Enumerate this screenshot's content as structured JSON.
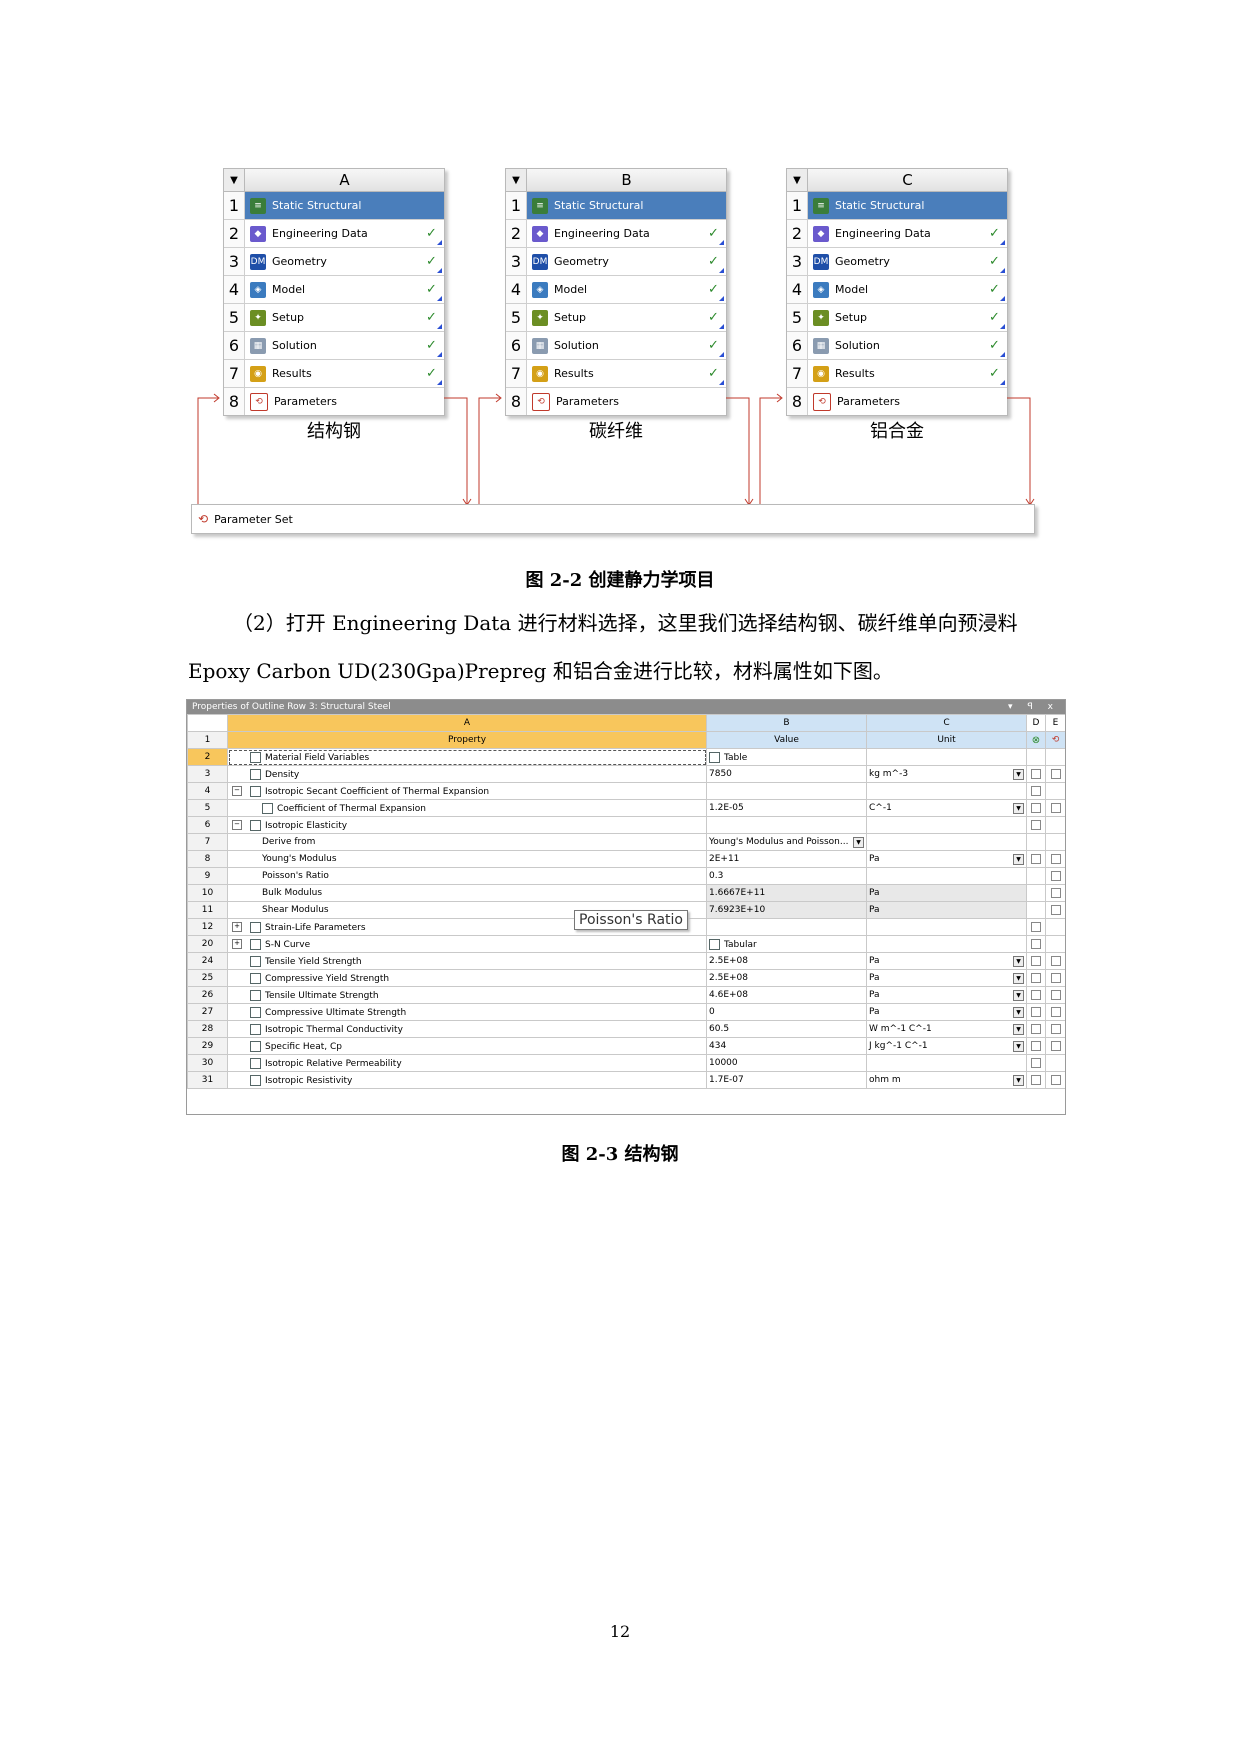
{
  "systems": [
    {
      "letter": "A",
      "caption": "结构钢"
    },
    {
      "letter": "B",
      "caption": "碳纤维"
    },
    {
      "letter": "C",
      "caption": "铝合金"
    }
  ],
  "cells": [
    {
      "num": "1",
      "label": "Static Structural",
      "icon": "static-structural-icon",
      "check": ""
    },
    {
      "num": "2",
      "label": "Engineering Data",
      "icon": "engineering-data-icon",
      "check": "✓"
    },
    {
      "num": "3",
      "label": "Geometry",
      "icon": "geometry-dm-icon",
      "check": "✓"
    },
    {
      "num": "4",
      "label": "Model",
      "icon": "model-icon",
      "check": "✓"
    },
    {
      "num": "5",
      "label": "Setup",
      "icon": "setup-icon",
      "check": "✓"
    },
    {
      "num": "6",
      "label": "Solution",
      "icon": "solution-icon",
      "check": "✓"
    },
    {
      "num": "7",
      "label": "Results",
      "icon": "results-icon",
      "check": "✓"
    },
    {
      "num": "8",
      "label": "Parameters",
      "icon": "parameters-icon",
      "check": ""
    }
  ],
  "parameter_set": "Parameter Set",
  "fig22": "图 2-2 创建静力学项目",
  "para_line1": "（2）打开 Engineering Data 进行材料选择，这里我们选择结构钢、碳纤维单向预浸料",
  "para_line2": "Epoxy Carbon UD(230Gpa)Prepreg 和铝合金进行比较，材料属性如下图。",
  "props": {
    "title": "Properties of Outline Row 3: Structural Steel",
    "controls": "▾ ꟼ x",
    "col_letters": [
      "A",
      "B",
      "C",
      "D",
      "E"
    ],
    "head": {
      "num": "1",
      "property": "Property",
      "value": "Value",
      "unit": "Unit"
    },
    "rows": [
      {
        "n": "2",
        "indent": 1,
        "exp": "",
        "name": "Material Field Variables",
        "value": "Table",
        "unit": "",
        "dd": false,
        "icon": true,
        "sel": true
      },
      {
        "n": "3",
        "indent": 1,
        "exp": "",
        "name": "Density",
        "value": "7850",
        "unit": "kg m^-3",
        "dd": true,
        "icon": true
      },
      {
        "n": "4",
        "indent": 1,
        "exp": "⊟",
        "name": "Isotropic Secant Coefficient of Thermal Expansion",
        "value": "",
        "unit": "",
        "dd": false,
        "icon": true
      },
      {
        "n": "5",
        "indent": 2,
        "exp": "",
        "name": "Coefficient of Thermal Expansion",
        "value": "1.2E-05",
        "unit": "C^-1",
        "dd": true,
        "icon": true
      },
      {
        "n": "6",
        "indent": 1,
        "exp": "⊟",
        "name": "Isotropic Elasticity",
        "value": "",
        "unit": "",
        "dd": false,
        "icon": true
      },
      {
        "n": "7",
        "indent": 3,
        "exp": "",
        "name": "Derive from",
        "value": "Young's Modulus and Poisson...",
        "unit": "",
        "dd": false,
        "icon": false,
        "vdd": true
      },
      {
        "n": "8",
        "indent": 3,
        "exp": "",
        "name": "Young's Modulus",
        "value": "2E+11",
        "unit": "Pa",
        "dd": true,
        "icon": false
      },
      {
        "n": "9",
        "indent": 3,
        "exp": "",
        "name": "Poisson's Ratio",
        "value": "0.3",
        "unit": "",
        "dd": false,
        "icon": false
      },
      {
        "n": "10",
        "indent": 3,
        "exp": "",
        "name": "Bulk Modulus",
        "value": "1.6667E+11",
        "unit": "Pa",
        "dd": false,
        "icon": false,
        "shade": true
      },
      {
        "n": "11",
        "indent": 3,
        "exp": "",
        "name": "Shear Modulus",
        "value": "7.6923E+10",
        "unit": "Pa",
        "dd": false,
        "icon": false,
        "shade": true
      },
      {
        "n": "12",
        "indent": 1,
        "exp": "⊞",
        "name": "Strain-Life Parameters",
        "value": "",
        "unit": "",
        "dd": false,
        "icon": true
      },
      {
        "n": "20",
        "indent": 1,
        "exp": "⊞",
        "name": "S-N Curve",
        "value": "Tabular",
        "unit": "",
        "dd": false,
        "icon": true
      },
      {
        "n": "24",
        "indent": 1,
        "exp": "",
        "name": "Tensile Yield Strength",
        "value": "2.5E+08",
        "unit": "Pa",
        "dd": true,
        "icon": true
      },
      {
        "n": "25",
        "indent": 1,
        "exp": "",
        "name": "Compressive Yield Strength",
        "value": "2.5E+08",
        "unit": "Pa",
        "dd": true,
        "icon": true
      },
      {
        "n": "26",
        "indent": 1,
        "exp": "",
        "name": "Tensile Ultimate Strength",
        "value": "4.6E+08",
        "unit": "Pa",
        "dd": true,
        "icon": true
      },
      {
        "n": "27",
        "indent": 1,
        "exp": "",
        "name": "Compressive Ultimate Strength",
        "value": "0",
        "unit": "Pa",
        "dd": true,
        "icon": true
      },
      {
        "n": "28",
        "indent": 1,
        "exp": "",
        "name": "Isotropic Thermal Conductivity",
        "value": "60.5",
        "unit": "W m^-1 C^-1",
        "dd": true,
        "icon": true
      },
      {
        "n": "29",
        "indent": 1,
        "exp": "",
        "name": "Specific Heat, Cp",
        "value": "434",
        "unit": "J kg^-1 C^-1",
        "dd": true,
        "icon": true
      },
      {
        "n": "30",
        "indent": 1,
        "exp": "",
        "name": "Isotropic Relative Permeability",
        "value": "10000",
        "unit": "",
        "dd": false,
        "icon": true
      },
      {
        "n": "31",
        "indent": 1,
        "exp": "",
        "name": "Isotropic Resistivity",
        "value": "1.7E-07",
        "unit": "ohm m",
        "dd": true,
        "icon": true
      }
    ],
    "tooltip": "Poisson's Ratio"
  },
  "fig23": "图 2-3 结构钢",
  "page_number": "12",
  "colors": {
    "highlight": "#4a7ebb",
    "link_line": "#c0392b",
    "header_orange": "#f8c65c",
    "header_blue": "#cfe3f5"
  }
}
